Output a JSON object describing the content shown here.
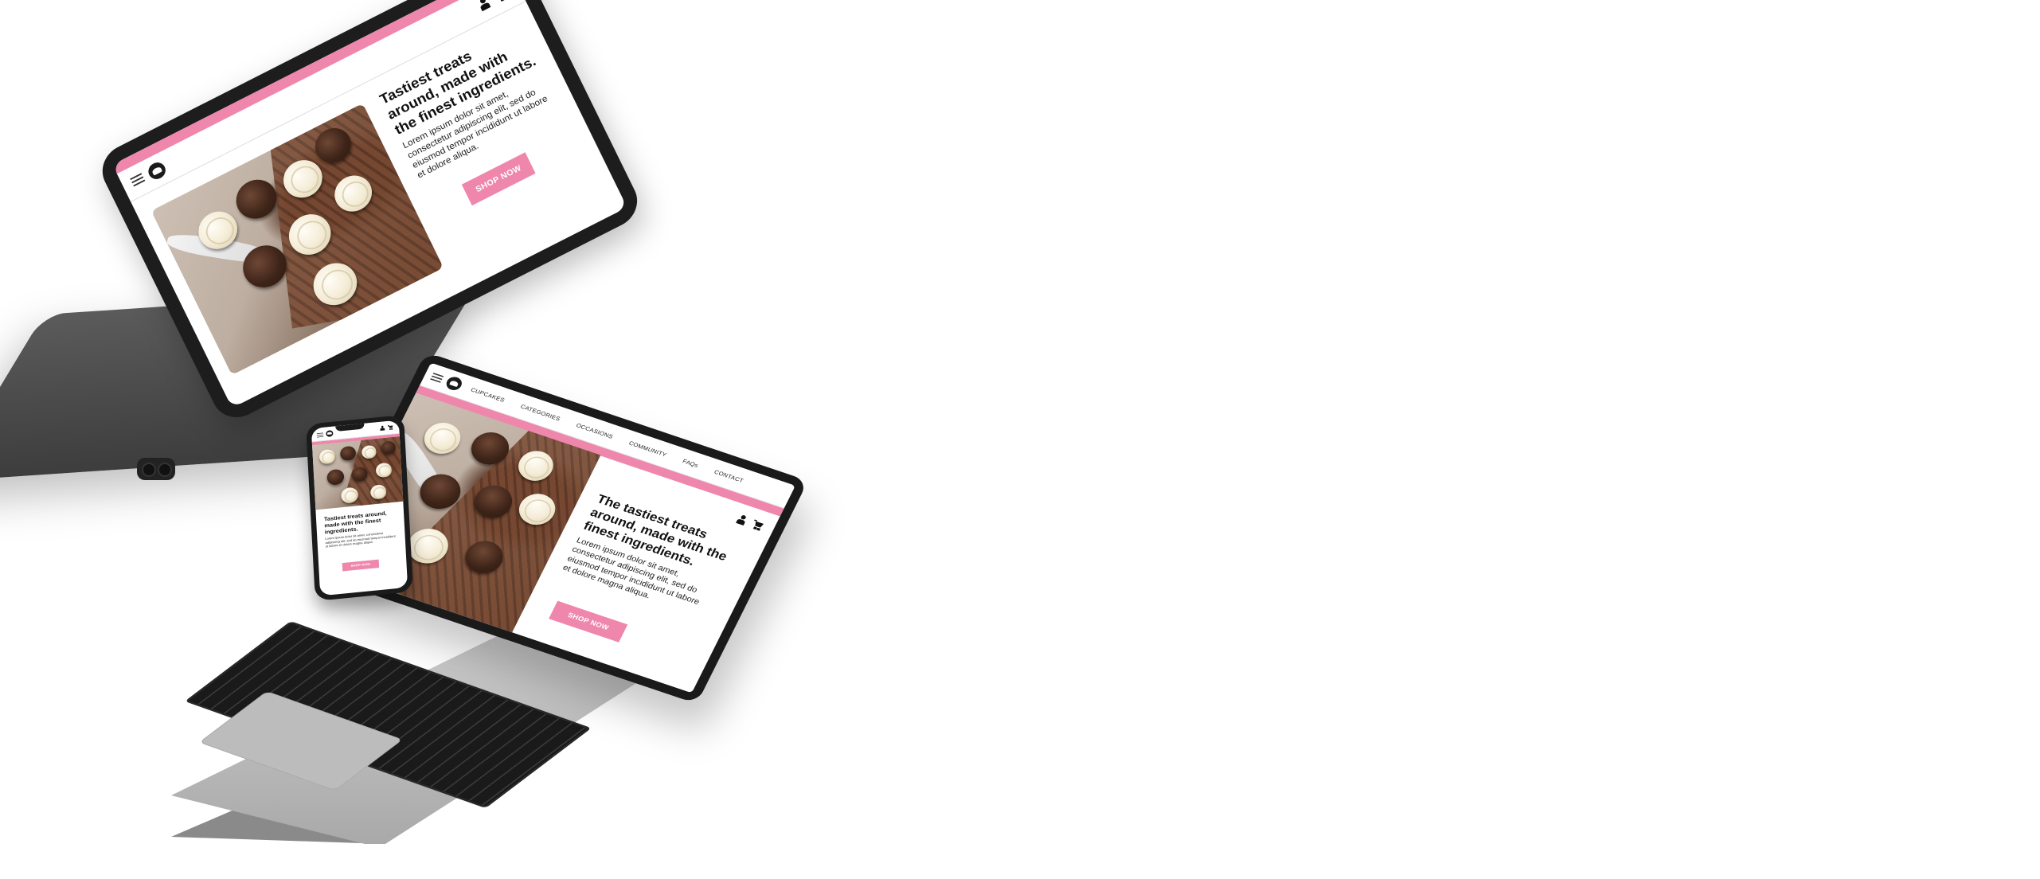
{
  "mockup": {
    "colors": {
      "accent": "#ef86ac",
      "text": "#111111",
      "device_dark": "#1d1d1d",
      "laptop_silver": "#c4c4c4"
    },
    "tablet": {
      "promo_text": "",
      "hero_title": "Tastiest treats around, made with the finest ingredients.",
      "hero_body": "Lorem ipsum dolor sit amet, consectetur adipiscing elit, sed do eiusmod tempor incididunt ut labore et dolore aliqua.",
      "cta": "SHOP NOW",
      "icons": [
        "menu-icon",
        "logo",
        "user-icon",
        "cart-icon"
      ]
    },
    "laptop": {
      "promo_text": "",
      "nav": [
        "CUPCAKES",
        "CATEGORIES",
        "OCCASIONS",
        "COMMUNITY",
        "FAQs",
        "CONTACT"
      ],
      "hero_title": "The tastiest treats around, made with the finest ingredients.",
      "hero_body": "Lorem ipsum dolor sit amet, consectetur adipiscing elit, sed do eiusmod tempor incididunt ut labore et dolore magna aliqua.",
      "cta": "SHOP NOW",
      "icons": [
        "menu-icon",
        "logo",
        "user-icon",
        "cart-icon"
      ]
    },
    "phone": {
      "hero_title": "Tastiest treats around, made with the finest ingredients.",
      "hero_body": "Lorem ipsum dolor sit amet, consectetur adipiscing elit, sed do eiusmod tempor incididunt ut labore et dolore magna aliqua.",
      "cta": "SHOP NOW",
      "icons": [
        "menu-icon",
        "logo",
        "user-icon",
        "cart-icon"
      ]
    }
  }
}
